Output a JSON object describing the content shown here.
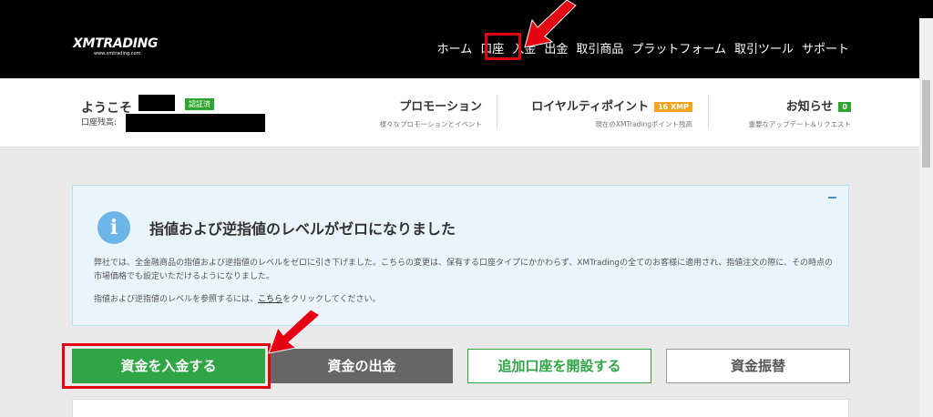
{
  "logo": {
    "main": "XMTRADING",
    "sub": "www.xmtrading.com"
  },
  "nav": {
    "items": [
      "ホーム",
      "口座",
      "入金",
      "出金",
      "取引商品",
      "プラットフォーム",
      "取引ツール",
      "サポート"
    ]
  },
  "account": {
    "welcome": "ようこそ",
    "verified_badge": "認証済",
    "balance_label": "口座残高:"
  },
  "stats": {
    "promotion": {
      "title": "プロモーション",
      "sub": "様々なプロモーションとイベント"
    },
    "loyalty": {
      "title": "ロイヤルティポイント",
      "badge": "16 XMP",
      "sub": "現在のXMTradingポイント残高"
    },
    "notices": {
      "title": "お知らせ",
      "badge": "0",
      "sub": "重要なアップデート＆リクエスト"
    }
  },
  "notice": {
    "title": "指値および逆指値のレベルがゼロになりました",
    "body": "弊社では、全金融商品の指値および逆指値のレベルをゼロに引き下げました。こちらの変更は、保有する口座タイプにかかわらず、XMTradingの全てのお客様に適用され、指値注文の際に、その時点の市場価格でも設定いただけるようになりました。",
    "link_prefix": "指値および逆指値のレベルを参照するには、",
    "link_text": "こちら",
    "link_suffix": "をクリックしてください。"
  },
  "actions": {
    "deposit": "資金を入金する",
    "withdraw": "資金の出金",
    "open_account": "追加口座を開設する",
    "transfer": "資金振替"
  },
  "colors": {
    "accent_green": "#30a545",
    "highlight_red": "#e50012",
    "nav_bg": "#000000",
    "info_blue": "#6bb6e6"
  }
}
